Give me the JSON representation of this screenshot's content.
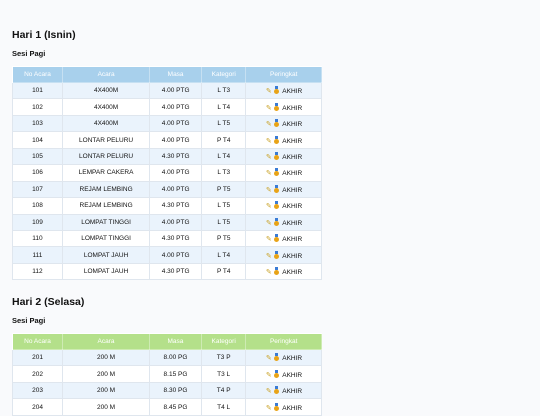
{
  "days": [
    {
      "title": "Hari 1 (Isnin)",
      "session": "Sesi Pagi",
      "headers": [
        "No Acara",
        "Acara",
        "Masa",
        "Kategori",
        "Peringkat"
      ],
      "rows": [
        {
          "no": "101",
          "acara": "4X400M",
          "masa": "4.00 PTG",
          "kategori": "L T3",
          "peringkat": "AKHIR"
        },
        {
          "no": "102",
          "acara": "4X400M",
          "masa": "4.00 PTG",
          "kategori": "L T4",
          "peringkat": "AKHIR"
        },
        {
          "no": "103",
          "acara": "4X400M",
          "masa": "4.00 PTG",
          "kategori": "L T5",
          "peringkat": "AKHIR"
        },
        {
          "no": "104",
          "acara": "LONTAR PELURU",
          "masa": "4.00 PTG",
          "kategori": "P T4",
          "peringkat": "AKHIR"
        },
        {
          "no": "105",
          "acara": "LONTAR PELURU",
          "masa": "4.30 PTG",
          "kategori": "L T4",
          "peringkat": "AKHIR"
        },
        {
          "no": "106",
          "acara": "LEMPAR CAKERA",
          "masa": "4.00 PTG",
          "kategori": "L T3",
          "peringkat": "AKHIR"
        },
        {
          "no": "107",
          "acara": "REJAM LEMBING",
          "masa": "4.00 PTG",
          "kategori": "P T5",
          "peringkat": "AKHIR"
        },
        {
          "no": "108",
          "acara": "REJAM LEMBING",
          "masa": "4.30 PTG",
          "kategori": "L T5",
          "peringkat": "AKHIR"
        },
        {
          "no": "109",
          "acara": "LOMPAT TINGGI",
          "masa": "4.00 PTG",
          "kategori": "L T5",
          "peringkat": "AKHIR"
        },
        {
          "no": "110",
          "acara": "LOMPAT TINGGI",
          "masa": "4.30 PTG",
          "kategori": "P T5",
          "peringkat": "AKHIR"
        },
        {
          "no": "111",
          "acara": "LOMPAT JAUH",
          "masa": "4.00 PTG",
          "kategori": "L T4",
          "peringkat": "AKHIR"
        },
        {
          "no": "112",
          "acara": "LOMPAT JAUH",
          "masa": "4.30 PTG",
          "kategori": "P T4",
          "peringkat": "AKHIR"
        }
      ]
    },
    {
      "title": "Hari 2 (Selasa)",
      "session": "Sesi Pagi",
      "headers": [
        "No Acara",
        "Acara",
        "Masa",
        "Kategori",
        "Peringkat"
      ],
      "rows": [
        {
          "no": "201",
          "acara": "200 M",
          "masa": "8.00 PG",
          "kategori": "T3 P",
          "peringkat": "AKHIR"
        },
        {
          "no": "202",
          "acara": "200 M",
          "masa": "8.15 PG",
          "kategori": "T3 L",
          "peringkat": "AKHIR"
        },
        {
          "no": "203",
          "acara": "200 M",
          "masa": "8.30 PG",
          "kategori": "T4 P",
          "peringkat": "AKHIR"
        },
        {
          "no": "204",
          "acara": "200 M",
          "masa": "8.45 PG",
          "kategori": "T4 L",
          "peringkat": "AKHIR"
        }
      ]
    }
  ],
  "icons": {
    "edit": "pencil-icon",
    "medal": "medal-icon"
  },
  "colors": {
    "day1_header": "#a8d0ec",
    "day2_header": "#b4e08a",
    "row_alt": "#eaf3fc"
  }
}
